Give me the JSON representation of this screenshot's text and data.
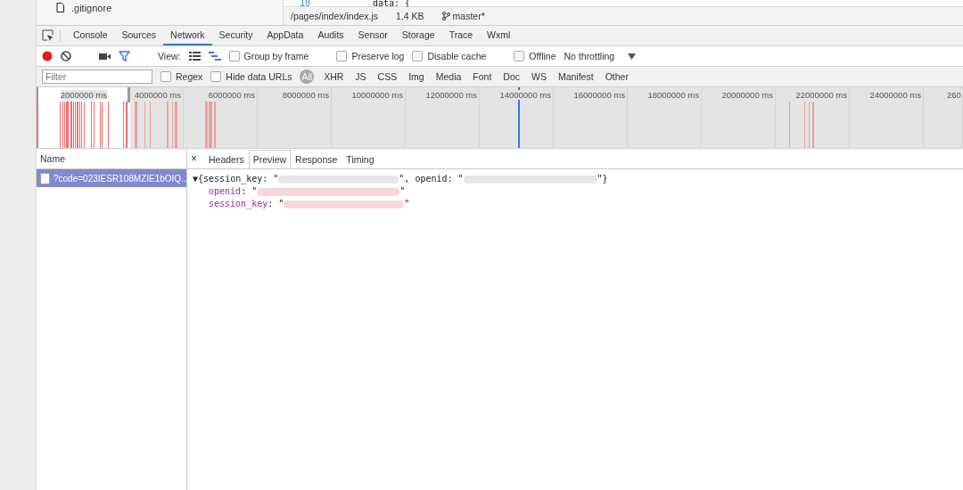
{
  "file_tree": {
    "items": [
      {
        "label": ".gitignore"
      }
    ]
  },
  "editor": {
    "line_number": "10",
    "code": "data: {",
    "status": {
      "path": "/pages/index/index.js",
      "size": "1.4 KB",
      "branch": "master*"
    }
  },
  "panel_tabs": [
    {
      "label": "Console",
      "selected": false
    },
    {
      "label": "Sources",
      "selected": false
    },
    {
      "label": "Network",
      "selected": true
    },
    {
      "label": "Security",
      "selected": false
    },
    {
      "label": "AppData",
      "selected": false
    },
    {
      "label": "Audits",
      "selected": false
    },
    {
      "label": "Sensor",
      "selected": false
    },
    {
      "label": "Storage",
      "selected": false
    },
    {
      "label": "Trace",
      "selected": false
    },
    {
      "label": "Wxml",
      "selected": false
    }
  ],
  "toolbar": {
    "recording": true,
    "filter_on": true,
    "view_label": "View:",
    "large_rows": false,
    "overview": true,
    "checkboxes": [
      {
        "label": "Group by frame",
        "checked": false
      },
      {
        "label": "Preserve log",
        "checked": false
      },
      {
        "label": "Disable cache",
        "checked": false
      },
      {
        "label": "Offline",
        "checked": false
      }
    ],
    "throttling": "No throttling"
  },
  "filter_bar": {
    "placeholder": "Filter",
    "checkboxes": [
      {
        "label": "Regex",
        "checked": false
      },
      {
        "label": "Hide data URLs",
        "checked": false
      }
    ],
    "types": [
      {
        "label": "All",
        "selected": true
      },
      {
        "label": "XHR",
        "selected": false
      },
      {
        "label": "JS",
        "selected": false
      },
      {
        "label": "CSS",
        "selected": false
      },
      {
        "label": "Img",
        "selected": false
      },
      {
        "label": "Media",
        "selected": false
      },
      {
        "label": "Font",
        "selected": false
      },
      {
        "label": "Doc",
        "selected": false
      },
      {
        "label": "WS",
        "selected": false
      },
      {
        "label": "Manifest",
        "selected": false
      },
      {
        "label": "Other",
        "selected": false
      }
    ]
  },
  "timeline": {
    "ticks": [
      "2000000 ms",
      "4000000 ms",
      "6000000 ms",
      "8000000 ms",
      "10000000 ms",
      "12000000 ms",
      "14000000 ms",
      "16000000 ms",
      "18000000 ms",
      "20000000 ms",
      "22000000 ms",
      "24000000 ms",
      "260"
    ]
  },
  "requests": {
    "column": "Name",
    "rows": [
      {
        "name": "?code=023IESR108MZIE1bOIQ...",
        "selected": true
      }
    ]
  },
  "details": {
    "close": "×",
    "tabs": [
      {
        "label": "Headers",
        "selected": false
      },
      {
        "label": "Preview",
        "selected": true
      },
      {
        "label": "Response",
        "selected": false
      },
      {
        "label": "Timing",
        "selected": false
      }
    ],
    "preview": {
      "toggle": "▼",
      "summary_start": "{session_key: \"",
      "summary_mid": "\", openid: \"",
      "summary_end": "\"}",
      "properties": [
        {
          "key": "openid",
          "sep": ": \"",
          "end": "\""
        },
        {
          "key": "session_key",
          "sep": ": \"",
          "end": "\""
        }
      ]
    }
  }
}
